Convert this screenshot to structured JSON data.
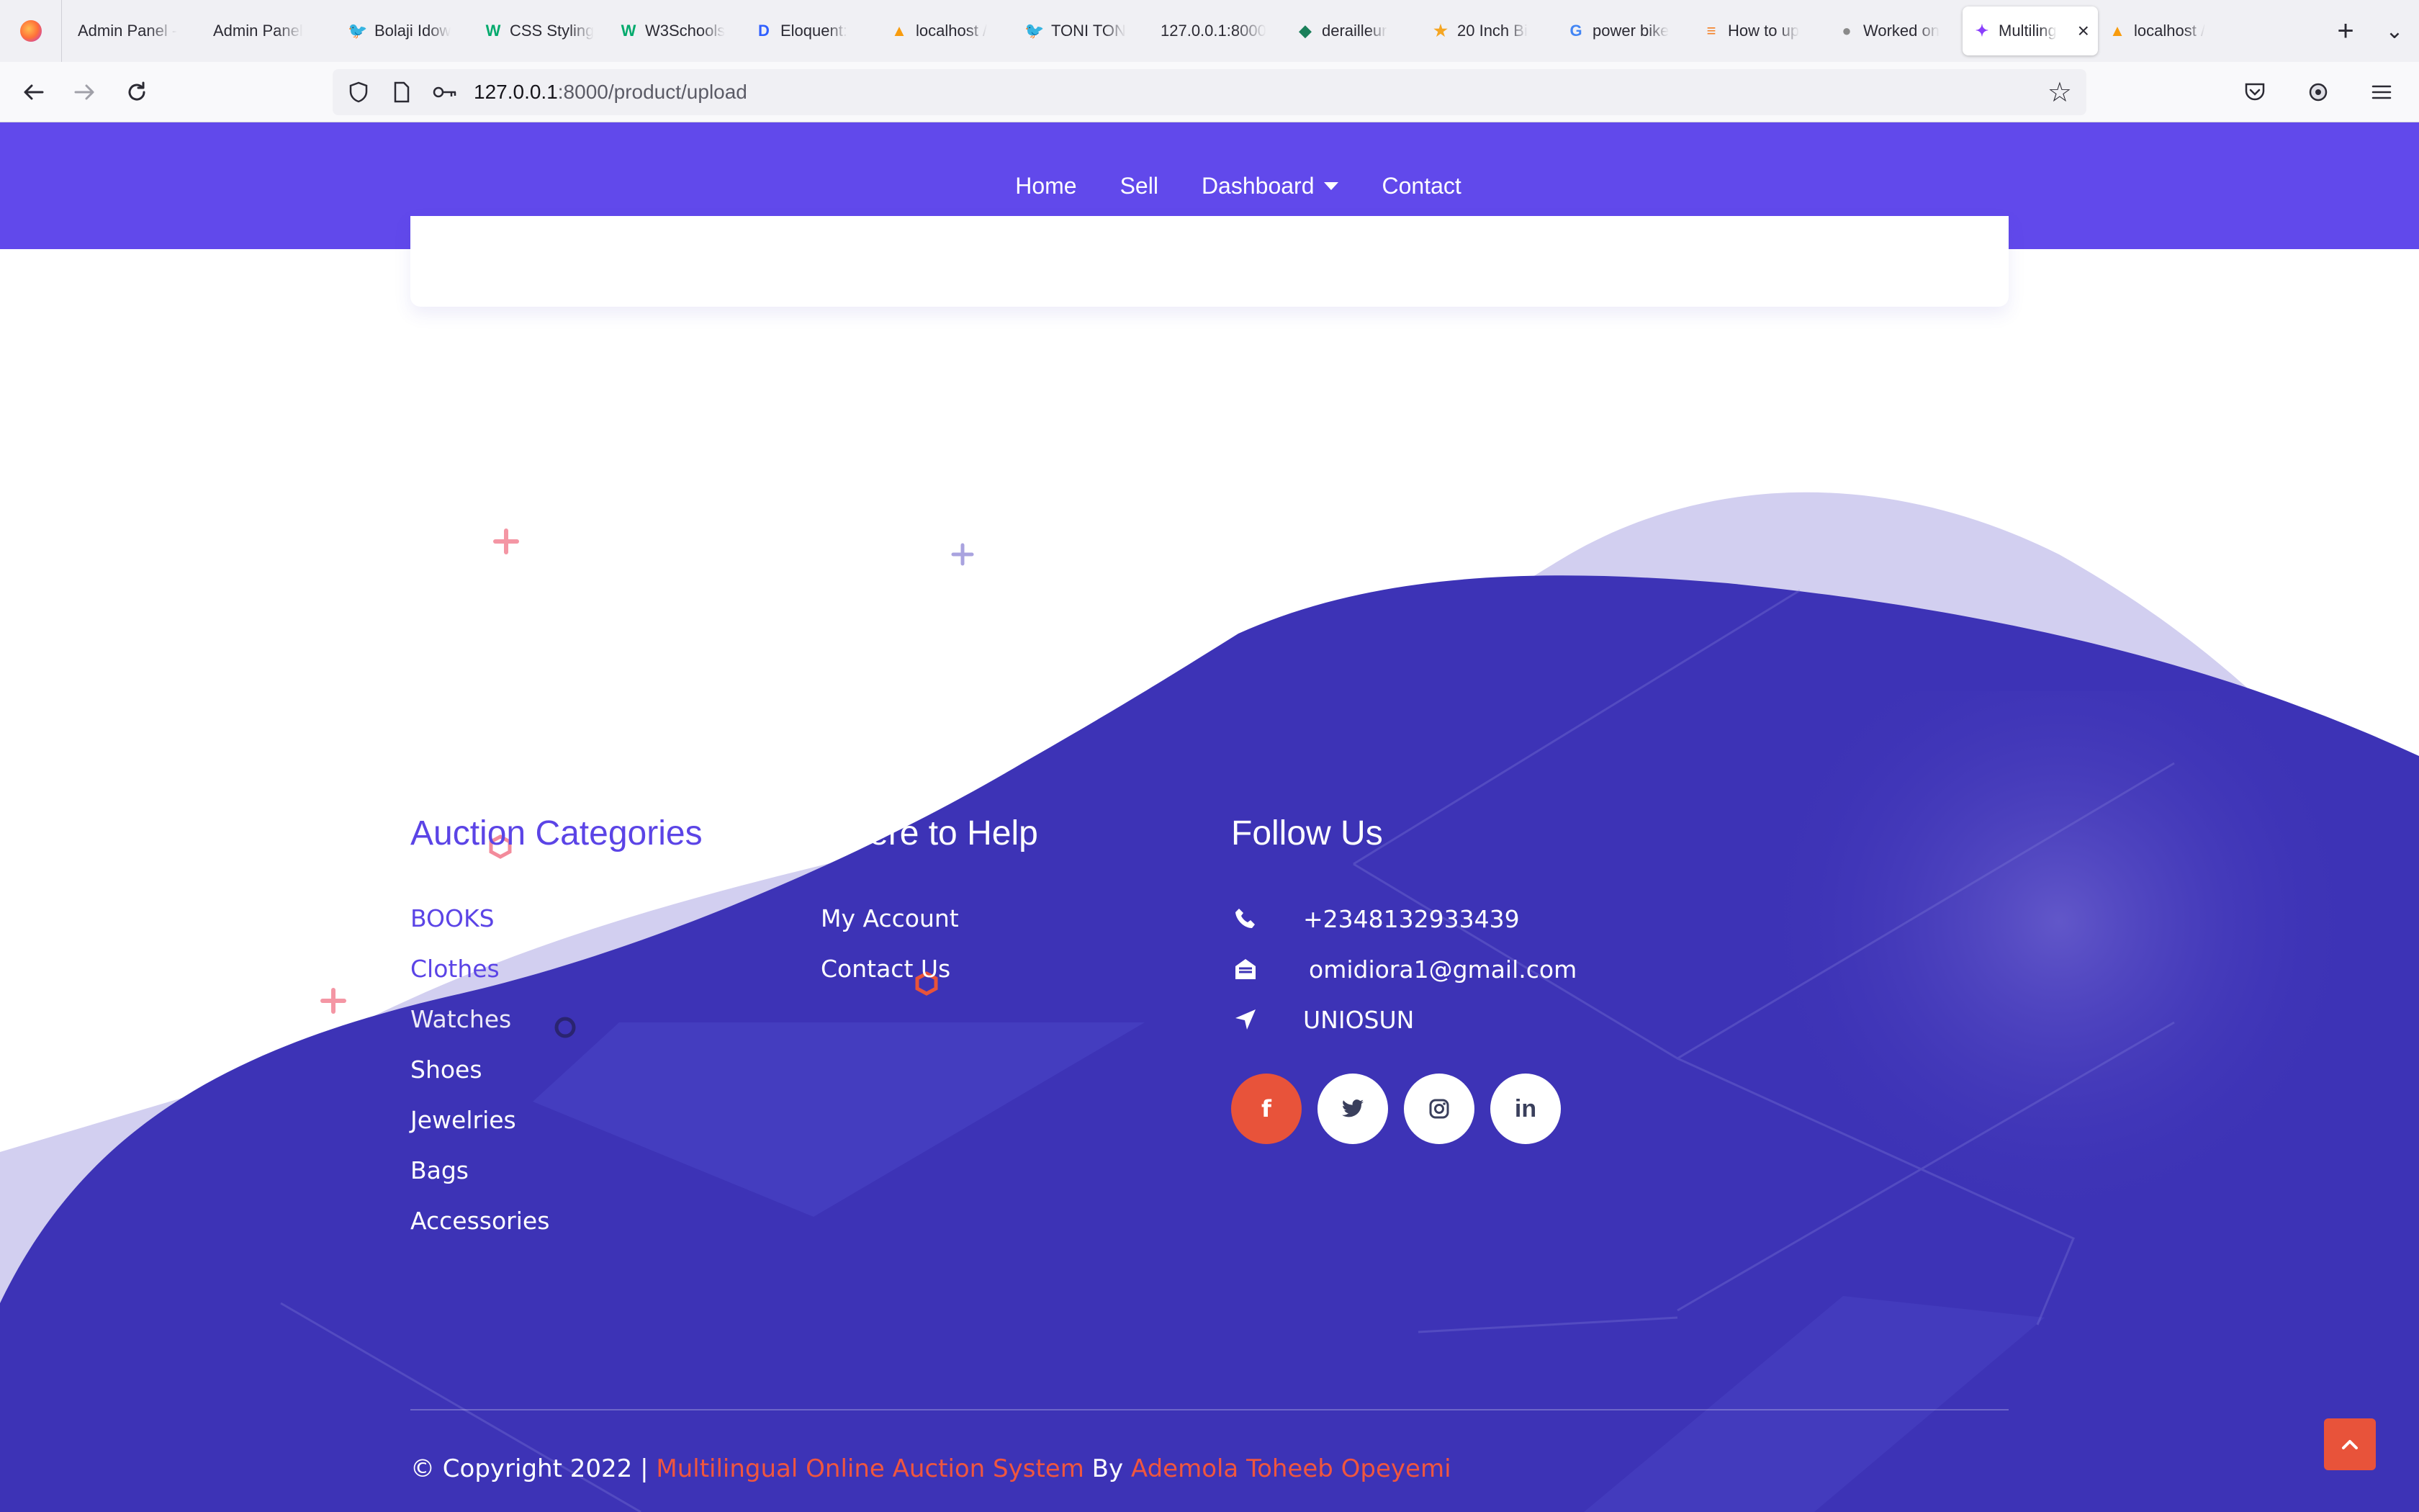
{
  "browser": {
    "tabs": [
      {
        "title": "Admin Panel -",
        "icon": "none"
      },
      {
        "title": "Admin Panel",
        "icon": "none"
      },
      {
        "title": "Bolaji Idow",
        "icon": "twitter-icon"
      },
      {
        "title": "CSS Styling",
        "icon": "w3schools-icon"
      },
      {
        "title": "W3Schools",
        "icon": "w3schools-icon"
      },
      {
        "title": "Eloquent:",
        "icon": "laravel-docs-icon"
      },
      {
        "title": "localhost /",
        "icon": "phpmyadmin-icon"
      },
      {
        "title": "TONI TON",
        "icon": "twitter-icon"
      },
      {
        "title": "127.0.0.1:8000",
        "icon": "none"
      },
      {
        "title": "derailleur",
        "icon": "shield-icon"
      },
      {
        "title": "20 Inch Bi",
        "icon": "star-badge-icon"
      },
      {
        "title": "power bike",
        "icon": "google-icon"
      },
      {
        "title": "How to up",
        "icon": "stackoverflow-icon"
      },
      {
        "title": "Worked on",
        "icon": "github-icon"
      },
      {
        "title": "Multiling",
        "icon": "site-icon",
        "active": true
      },
      {
        "title": "localhost /",
        "icon": "phpmyadmin-icon"
      }
    ],
    "url_host": "127.0.0.1",
    "url_rest": ":8000/product/upload"
  },
  "header": {
    "nav": [
      "Home",
      "Sell",
      "Dashboard",
      "Contact"
    ]
  },
  "footer": {
    "categories_title": "Auction Categories",
    "categories": [
      "BOOKS",
      "Clothes",
      "Watches",
      "Shoes",
      "Jewelries",
      "Bags",
      "Accessories"
    ],
    "help_title": "We're here to Help",
    "help_links": [
      "My Account",
      "Contact Us"
    ],
    "follow_title": "Follow Us",
    "phone": "+2348132933439",
    "email": "omidiora1@gmail.com",
    "location": "UNIOSUN",
    "socials": [
      "facebook-icon",
      "twitter-icon",
      "instagram-icon",
      "linkedin-icon"
    ],
    "copyright_prefix": "© Copyright 2022 |",
    "copyright_project": "Multilingual Online Auction System",
    "copyright_by": "By",
    "copyright_author": "Ademola Toheeb Opeyemi"
  },
  "colors": {
    "header": "#6149eb",
    "footer": "#3d33b6",
    "accent": "#e8533a",
    "light_wave": "#d2cff0"
  }
}
